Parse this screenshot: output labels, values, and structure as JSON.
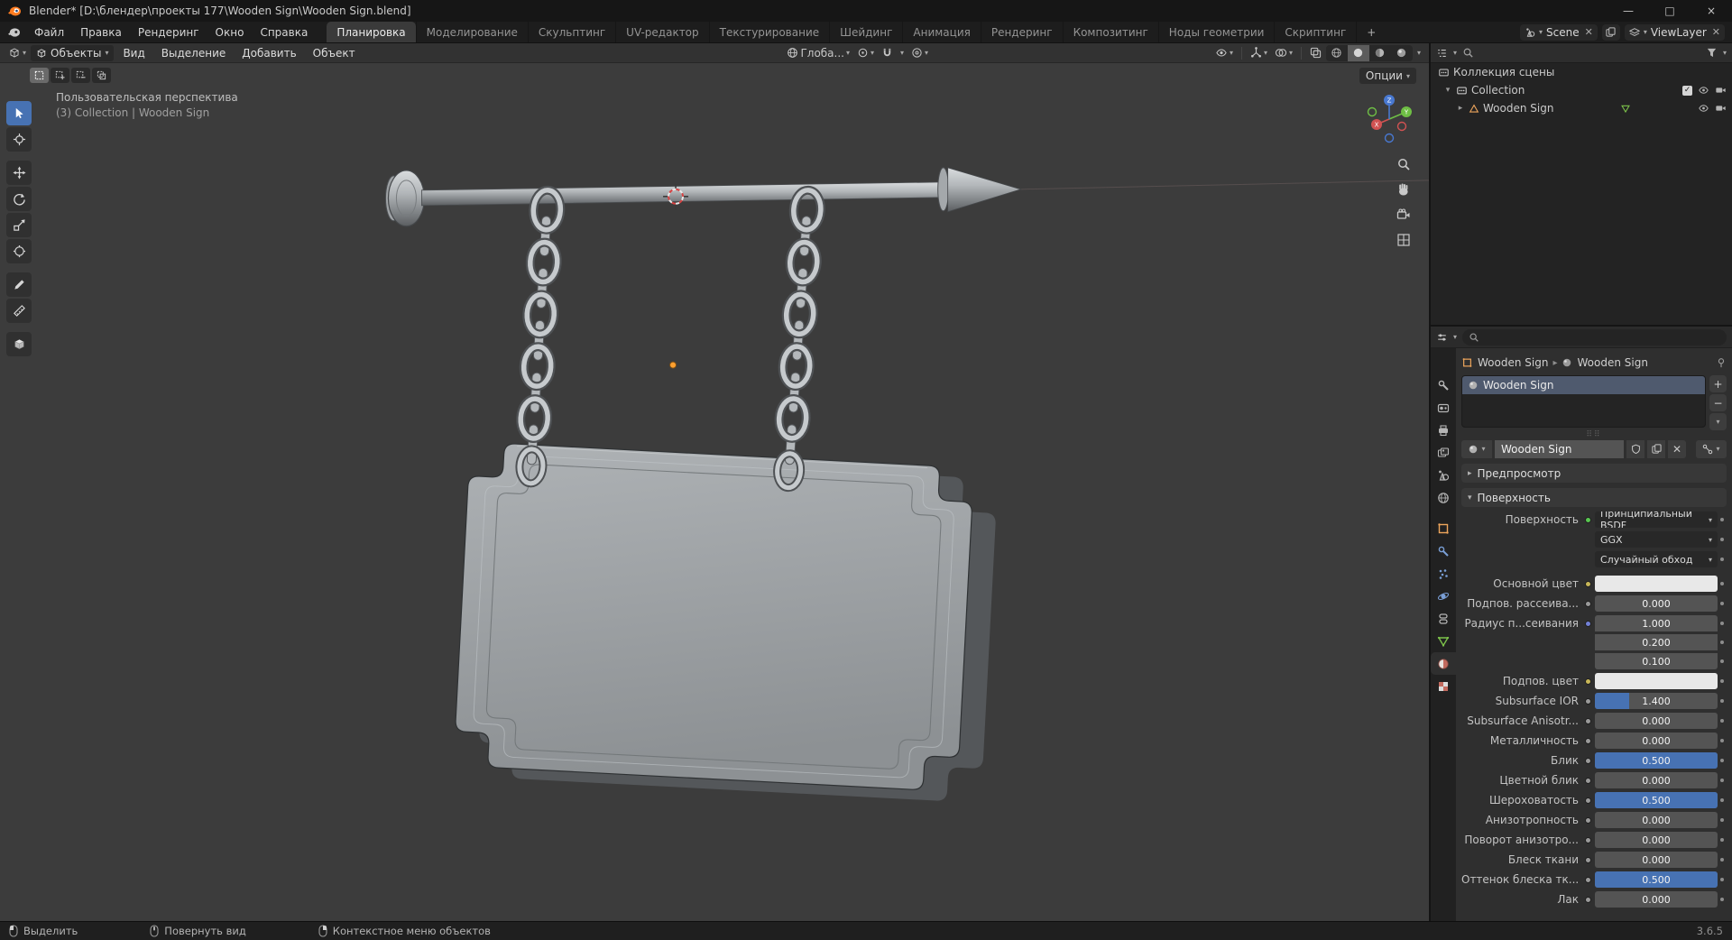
{
  "colors": {
    "accent": "#4772b3",
    "axis_x": "#e24d4d",
    "axis_y": "#6fbf45",
    "axis_z": "#3d6fd0",
    "object_orange": "#eda55c",
    "mesh_green": "#7cc24a"
  },
  "title_bar": {
    "title": "Blender* [D:\\блендер\\проекты 177\\Wooden Sign\\Wooden Sign.blend]",
    "minimize": "—",
    "maximize": "□",
    "close": "×"
  },
  "topbar": {
    "menus": [
      "Файл",
      "Правка",
      "Рендеринг",
      "Окно",
      "Справка"
    ],
    "workspaces": [
      {
        "label": "Планировка",
        "active": true
      },
      {
        "label": "Моделирование"
      },
      {
        "label": "Скульптинг"
      },
      {
        "label": "UV-редактор"
      },
      {
        "label": "Текстурирование"
      },
      {
        "label": "Шейдинг"
      },
      {
        "label": "Анимация"
      },
      {
        "label": "Рендеринг"
      },
      {
        "label": "Композитинг"
      },
      {
        "label": "Ноды геометрии"
      },
      {
        "label": "Скриптинг"
      }
    ],
    "add_workspace": "+",
    "scene": {
      "label": "Scene"
    },
    "view_layer": {
      "label": "ViewLayer"
    }
  },
  "viewport_header": {
    "mode": "Объекты",
    "menus": [
      "Вид",
      "Выделение",
      "Добавить",
      "Объект"
    ],
    "orientation": "Глоба...",
    "shading_modes": [
      "wireframe",
      "solid",
      "material",
      "rendered"
    ],
    "active_shading": "solid"
  },
  "viewport": {
    "view_label": "Пользовательская перспектива",
    "context_label": "(3) Collection | Wooden Sign",
    "options_label": "Опции",
    "tools": [
      "select-box",
      "cursor",
      "move",
      "rotate",
      "scale",
      "transform",
      "annotate",
      "measure",
      "add-cube"
    ],
    "active_tool": "select-box"
  },
  "outliner": {
    "rows": [
      {
        "label": "Коллекция сцены"
      },
      {
        "label": "Collection"
      },
      {
        "label": "Wooden Sign"
      }
    ]
  },
  "properties": {
    "tabs": [
      "tool",
      "render",
      "output",
      "view-layer",
      "scene",
      "world",
      "object",
      "modifiers",
      "particles",
      "physics",
      "constraints",
      "data",
      "material",
      "texture"
    ],
    "active_tab": "material",
    "breadcrumb": {
      "object": "Wooden Sign",
      "material": "Wooden Sign"
    },
    "slot": {
      "name": "Wooden Sign"
    },
    "material_field": {
      "name": "Wooden Sign"
    },
    "panels": {
      "preview": "Предпросмотр",
      "surface": "Поверхность"
    },
    "socket_colors": {
      "green": "#58c750",
      "yellow": "#c8b758",
      "gray": "#9a9a9a",
      "vector": "#7280d6"
    },
    "surface_rows": [
      {
        "label": "Поверхность",
        "widget": "menu",
        "value": "Принципиальный BSDF",
        "socket": "green"
      },
      {
        "widget": "menu",
        "value": "GGX"
      },
      {
        "widget": "menu",
        "value": "Случайный обход"
      },
      {
        "label": "Основной цвет",
        "widget": "color",
        "socket": "yellow",
        "gap": true
      },
      {
        "label": "Подпов. рассеива...",
        "widget": "value",
        "value": "0.000",
        "socket": "gray"
      },
      {
        "label": "Радиус п...сеивания",
        "widget": "value",
        "value": "1.000",
        "socket": "vector",
        "stack": "top"
      },
      {
        "widget": "value",
        "value": "0.200",
        "stack": "mid"
      },
      {
        "widget": "value",
        "value": "0.100",
        "stack": "bot"
      },
      {
        "label": "Подпов. цвет",
        "widget": "color",
        "socket": "yellow"
      },
      {
        "label": "Subsurface IOR",
        "widget": "slider",
        "value": "1.400",
        "fill": 0.28,
        "socket": "gray"
      },
      {
        "label": "Subsurface Anisotr...",
        "widget": "value",
        "value": "0.000",
        "socket": "gray"
      },
      {
        "label": "Металличность",
        "widget": "slider",
        "value": "0.000",
        "fill": 0,
        "socket": "gray"
      },
      {
        "label": "Блик",
        "widget": "slider",
        "value": "0.500",
        "fill": 1,
        "socket": "gray"
      },
      {
        "label": "Цветной блик",
        "widget": "slider",
        "value": "0.000",
        "fill": 0,
        "socket": "gray"
      },
      {
        "label": "Шероховатость",
        "widget": "slider",
        "value": "0.500",
        "fill": 1,
        "socket": "gray"
      },
      {
        "label": "Анизотропность",
        "widget": "value",
        "value": "0.000",
        "socket": "gray"
      },
      {
        "label": "Поворот анизотро...",
        "widget": "value",
        "value": "0.000",
        "socket": "gray"
      },
      {
        "label": "Блеск ткани",
        "widget": "value",
        "value": "0.000",
        "socket": "gray"
      },
      {
        "label": "Оттенок блеска тк...",
        "widget": "slider",
        "value": "0.500",
        "fill": 1,
        "socket": "gray"
      },
      {
        "label": "Лак",
        "widget": "value",
        "value": "0.000",
        "socket": "gray"
      }
    ]
  },
  "status_bar": {
    "items": [
      "Выделить",
      "Повернуть вид",
      "Контекстное меню объектов"
    ],
    "version": "3.6.5"
  }
}
